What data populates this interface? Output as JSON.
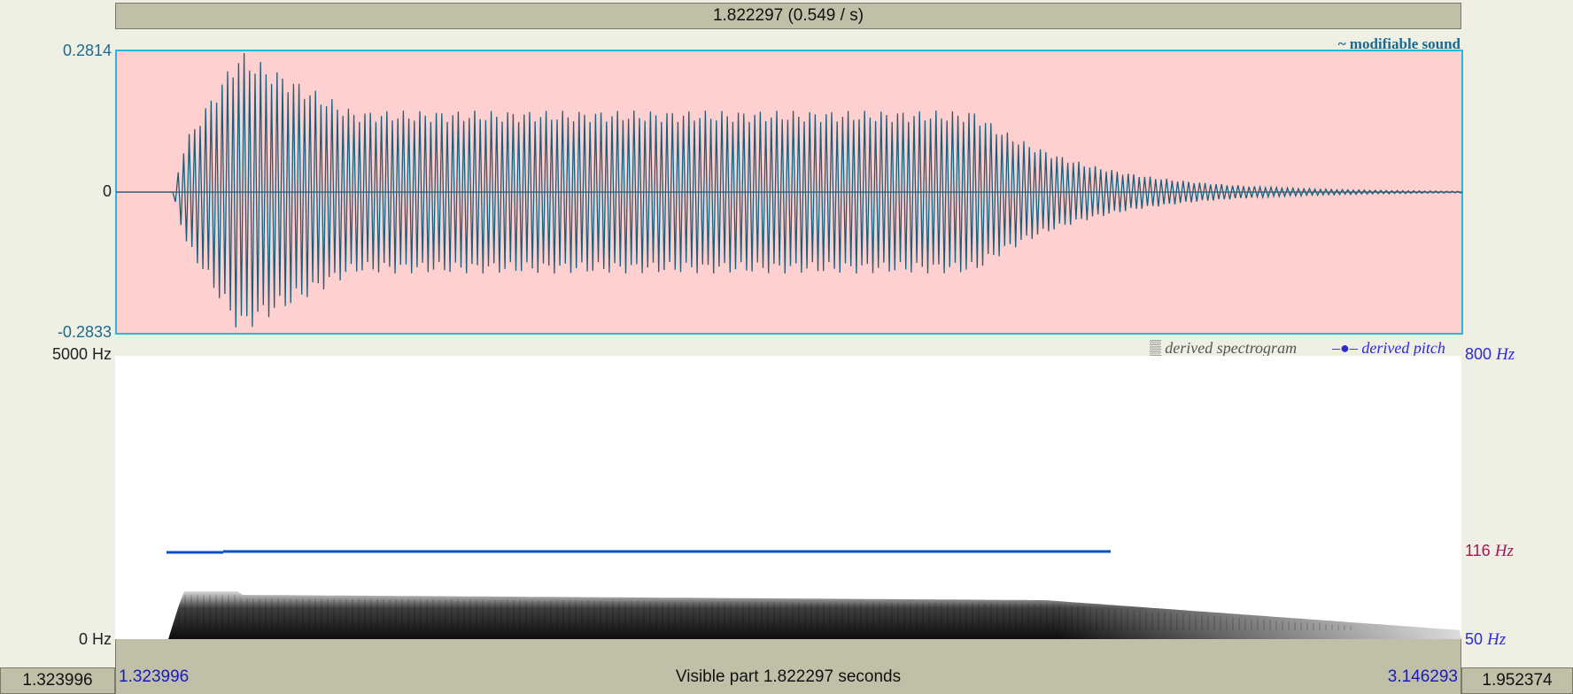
{
  "top_bar": {
    "selection_text": "1.822297 (0.549 / s)"
  },
  "waveform": {
    "y_max_label": "0.2814",
    "y_zero_label": "0",
    "y_min_label": "-0.2833",
    "tag": "~ modifiable sound",
    "background": "#ffd0d0",
    "border_color": "#22b8e0",
    "trace_color": "#1a5f7a"
  },
  "spectrogram": {
    "freq_max_label": "5000 Hz",
    "freq_min_label": "0 Hz",
    "legend_spectrogram_icon": "▒",
    "legend_spectrogram": "derived spectrogram",
    "legend_pitch_icon": "–●–",
    "legend_pitch": "derived pitch",
    "pitch_max_num": "800",
    "pitch_mid_num": "116",
    "pitch_min_num": "50",
    "hz_unit": "Hz",
    "pitch_color": "#0050d0"
  },
  "bottom_bar": {
    "window_start": "1.323996",
    "visible_text": "Visible part 1.822297 seconds",
    "window_end": "3.146293"
  },
  "corners": {
    "left": "1.323996",
    "right": "1.952374"
  }
}
